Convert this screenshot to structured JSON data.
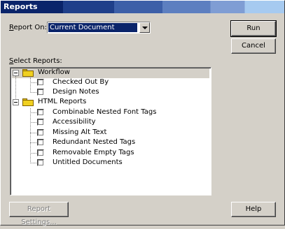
{
  "window": {
    "title": "Reports",
    "titlebar_colors": [
      "#0a246a",
      "#1f3f8a",
      "#3c5fa8",
      "#5d7fc0",
      "#7f9dd4",
      "#a6caf0"
    ]
  },
  "report_on": {
    "label_prefix": "",
    "label_underline": "R",
    "label_rest": "eport On:",
    "selected_value": "Current Document"
  },
  "select_reports_label": {
    "underline": "S",
    "rest": "elect Reports:"
  },
  "buttons": {
    "run": "Run",
    "cancel": "Cancel",
    "report_settings": "Report Settings...",
    "help": "Help"
  },
  "tree": {
    "groups": [
      {
        "label": "Workflow",
        "expanded": true,
        "items": [
          "Checked Out By",
          "Design Notes"
        ]
      },
      {
        "label": "HTML Reports",
        "expanded": true,
        "items": [
          "Combinable Nested Font Tags",
          "Accessibility",
          "Missing Alt Text",
          "Redundant Nested Tags",
          "Removable Empty Tags",
          "Untitled Documents"
        ]
      }
    ]
  }
}
